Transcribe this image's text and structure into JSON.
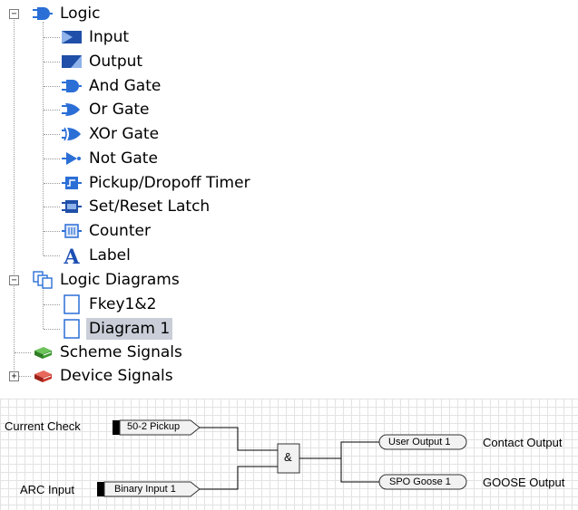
{
  "tree": {
    "root_logic": "Logic",
    "logic_items": [
      {
        "label": "Input",
        "icon": "input-icon"
      },
      {
        "label": "Output",
        "icon": "output-icon"
      },
      {
        "label": "And Gate",
        "icon": "and-gate-icon"
      },
      {
        "label": "Or Gate",
        "icon": "or-gate-icon"
      },
      {
        "label": "XOr Gate",
        "icon": "xor-gate-icon"
      },
      {
        "label": "Not Gate",
        "icon": "not-gate-icon"
      },
      {
        "label": "Pickup/Dropoff Timer",
        "icon": "timer-icon"
      },
      {
        "label": "Set/Reset Latch",
        "icon": "latch-icon"
      },
      {
        "label": "Counter",
        "icon": "counter-icon"
      },
      {
        "label": "Label",
        "icon": "label-icon"
      }
    ],
    "root_diagrams": "Logic Diagrams",
    "diagram_items": [
      {
        "label": "Fkey1&2",
        "icon": "diagram-page-icon"
      },
      {
        "label": "Diagram 1",
        "icon": "diagram-page-icon",
        "selected": true
      }
    ],
    "scheme_signals": "Scheme Signals",
    "device_signals": "Device Signals",
    "expander_open": "−",
    "expander_closed": "+"
  },
  "diagram": {
    "inputs": [
      {
        "name": "Current Check",
        "tag": "50-2 Pickup"
      },
      {
        "name": "ARC Input",
        "tag": "Binary Input 1"
      }
    ],
    "gate": "&",
    "outputs": [
      {
        "tag": "User Output 1",
        "name": "Contact Output"
      },
      {
        "tag": "SPO Goose 1",
        "name": "GOOSE Output"
      }
    ]
  },
  "colors": {
    "selection": "#c9ced8",
    "gate_blue": "#2b6fd6",
    "book_green": "#3a9a2e",
    "book_red": "#c8362a"
  }
}
